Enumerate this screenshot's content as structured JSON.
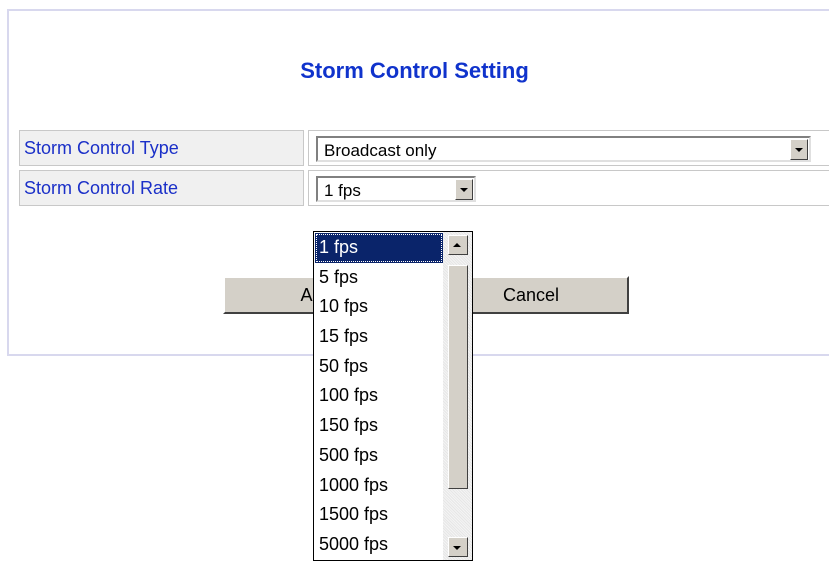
{
  "page": {
    "title": "Storm Control Setting"
  },
  "form": {
    "type_label": "Storm Control Type",
    "type_value": "Broadcast only",
    "rate_label": "Storm Control Rate",
    "rate_value": "1 fps"
  },
  "buttons": {
    "apply_label": "Apply",
    "cancel_label": "Cancel"
  },
  "dropdown": {
    "open": true,
    "selected_index": 0,
    "options": [
      "1 fps",
      "5 fps",
      "10 fps",
      "15 fps",
      "50 fps",
      "100 fps",
      "150 fps",
      "500 fps",
      "1000 fps",
      "1500 fps",
      "5000 fps"
    ]
  },
  "colors": {
    "title": "#1033cc",
    "label_text": "#1a2fc8",
    "label_bg": "#f0f0f0",
    "selection_bg": "#0a246a",
    "button_face": "#d4d0c8"
  },
  "icons": {
    "dropdown_arrow": "chevron-down-icon",
    "scroll_up": "arrow-up-icon",
    "scroll_down": "arrow-down-icon"
  }
}
